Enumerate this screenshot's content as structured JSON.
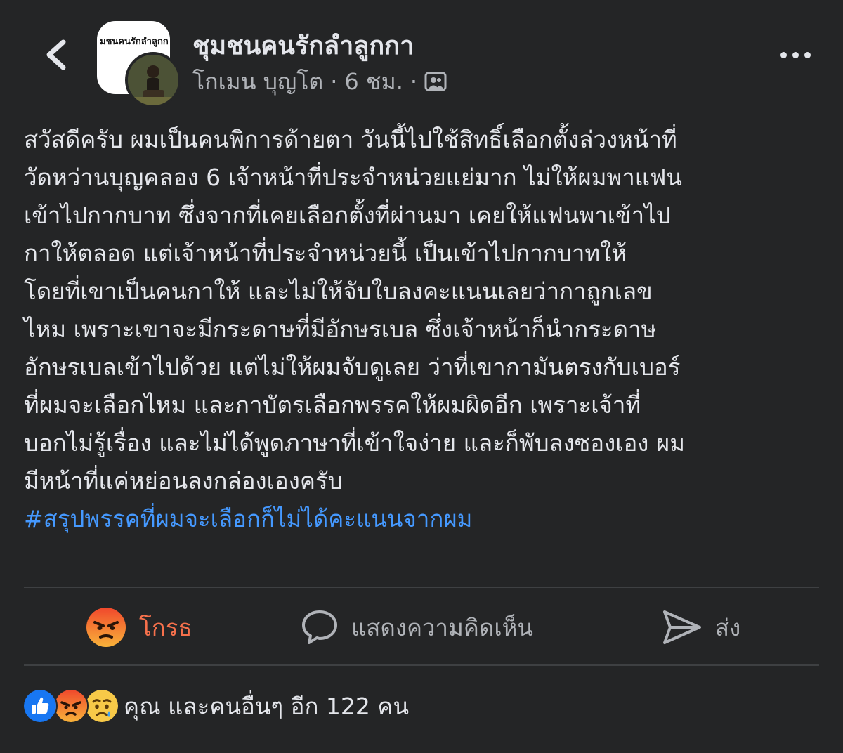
{
  "header": {
    "back_icon": "chevron-left-icon",
    "group_avatar_text": "มชนคนรักลำลูกก",
    "group_name": "ชุมชนคนรักลำลูกกา",
    "author": "โกเมน บุญโต",
    "separator": "·",
    "time": "6 ชม.",
    "audience_icon": "group-members-icon",
    "more_icon": "more-dots-icon"
  },
  "post": {
    "lines": [
      "สวัสดีครับ ผมเป็นคนพิการด้ายตา วันนี้ไปใช้สิทธิ์เลือกตั้งล่วงหน้าที่",
      "วัดหว่านบุญคลอง 6 เจ้าหน้าที่ประจำหน่วยแย่มาก ไม่ให้ผมพาแฟน",
      "เข้าไปกากบาท ซึ่งจากที่เคยเลือกตั้งที่ผ่านมา เคยให้แฟนพาเข้าไป",
      "กาให้ตลอด แต่เจ้าหน้าที่ประจำหน่วยนี้ เป็นเข้าไปกากบาทให้",
      "โดยที่เขาเป็นคนกาให้ และไม่ให้จับใบลงคะแนนเลยว่ากาถูกเลข",
      "ไหม เพราะเขาจะมีกระดาษที่มีอักษรเบล ซึ่งเจ้าหน้าก็นำกระดาษ",
      "อักษรเบลเข้าไปด้วย แต่ไม่ให้ผมจับดูเลย ว่าที่เขากามันตรงกับเบอร์",
      "ที่ผมจะเลือกไหม และกาบัตรเลือกพรรคให้ผมผิดอีก เพราะเจ้าที่",
      "บอกไม่รู้เรื่อง และไม่ได้พูดภาษาที่เข้าใจง่าย และก็พับลงซองเอง ผม",
      "มีหน้าที่แค่หย่อนลงกล่องเองครับ"
    ],
    "hashtag": "#สรุปพรรคที่ผมจะเลือกก็ไม่ได้คะแนนจากผม"
  },
  "actions": {
    "angry_label": "โกรธ",
    "comment_label": "แสดงความคิดเห็น",
    "share_label": "ส่ง",
    "angry_icon": "angry-reaction-icon",
    "comment_icon": "comment-bubble-icon",
    "share_icon": "send-icon"
  },
  "reactions": {
    "icons": [
      "like-reaction-icon",
      "angry-reaction-icon",
      "sad-reaction-icon"
    ],
    "summary": "คุณ และคนอื่นๆ อีก 122 คน"
  },
  "colors": {
    "background": "#242526",
    "text": "#e4e6eb",
    "muted": "#b0b3b8",
    "hashtag": "#4599ff",
    "angry": "#f7714c",
    "like": "#1877f2",
    "divider": "#3e4042"
  }
}
